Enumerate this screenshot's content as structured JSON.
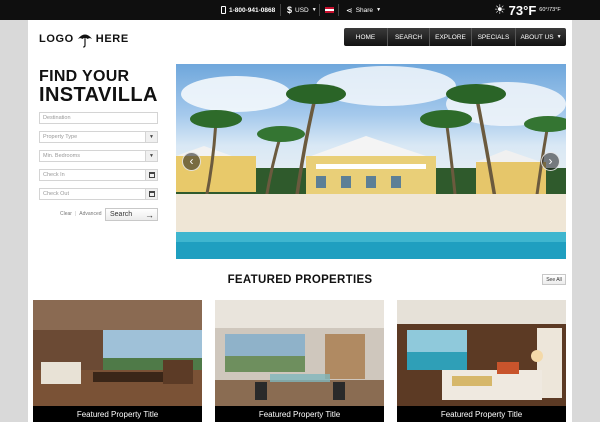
{
  "topbar": {
    "phone": "1-800-941-0868",
    "currency": "USD",
    "share": "Share",
    "temperature": "73°F",
    "temperature_range": "60°/73°F",
    "icons": [
      "phone-icon",
      "dollar-icon",
      "flag-icon",
      "share-icon",
      "sun-icon"
    ]
  },
  "header": {
    "logo_left": "LOGO",
    "logo_right": "HERE",
    "nav": [
      "HOME",
      "SEARCH",
      "EXPLORE",
      "SPECIALS",
      "ABOUT US"
    ]
  },
  "search": {
    "title_line1": "FIND YOUR",
    "title_line2": "INSTAVILLA",
    "destination_placeholder": "Destination",
    "property_type": "Property Type",
    "min_bedrooms": "Min. Bedrooms",
    "check_in": "Check In",
    "check_out": "Check Out",
    "clear": "Clear",
    "advanced": "Advanced",
    "search_button": "Search"
  },
  "featured": {
    "title": "FEATURED PROPERTIES",
    "see_all": "See All",
    "cards": [
      {
        "title": "Featured Property Title"
      },
      {
        "title": "Featured Property Title"
      },
      {
        "title": "Featured Property Title"
      }
    ]
  },
  "colors": {
    "topbar_bg": "#0f0f0f",
    "page_bg": "#d9d9d9",
    "nav_bg": "#1c1c1c",
    "caption_bg": "#000000"
  }
}
